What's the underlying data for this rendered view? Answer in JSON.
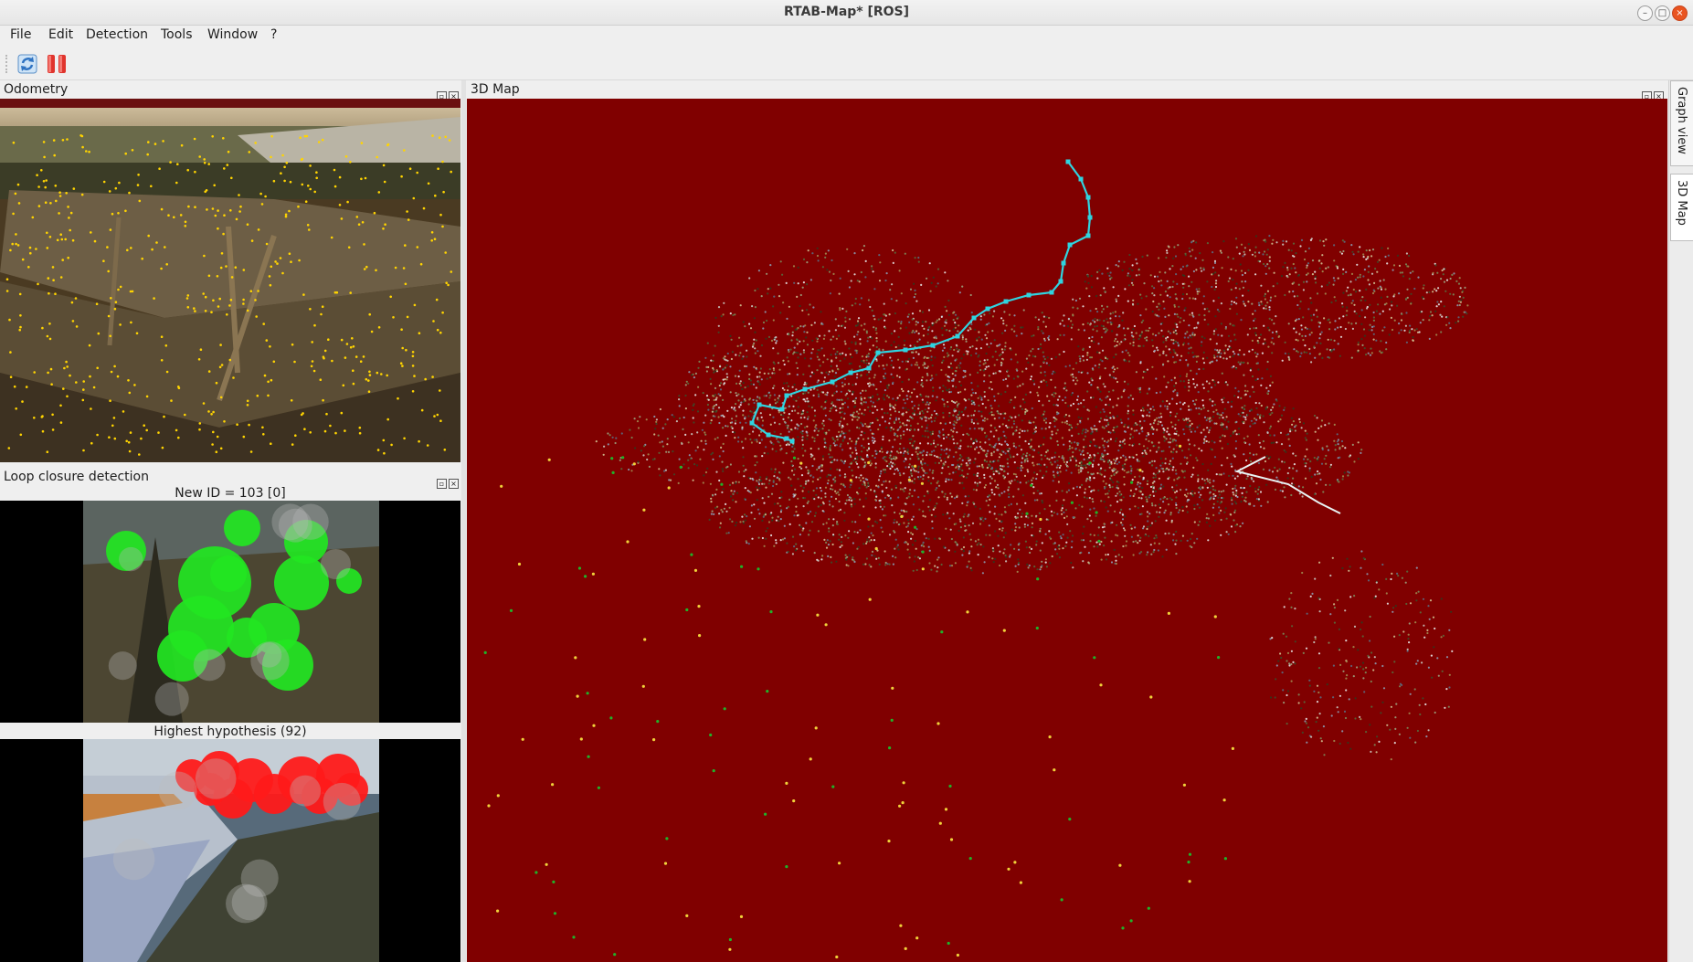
{
  "window": {
    "title": "RTAB-Map* [ROS]",
    "min_glyph": "–",
    "max_glyph": "□",
    "close_glyph": "×"
  },
  "menu": [
    "File",
    "Edit",
    "Detection",
    "Tools",
    "Window",
    "?"
  ],
  "toolbar": {
    "icons": [
      "refresh-icon",
      "pause-icon"
    ]
  },
  "odometry": {
    "title": "Odometry"
  },
  "loop_closure": {
    "title": "Loop closure detection",
    "new_caption": "New ID = 103 [0]",
    "hypothesis_caption": "Highest hypothesis (92)"
  },
  "map3d": {
    "title": "3D Map"
  },
  "side_tabs": [
    "Graph view",
    "3D Map"
  ],
  "colors": {
    "map_bg": "#800000",
    "trajectory": "#2fd4e0",
    "features_odom": "#ffd400",
    "new_loop_features": "#22e622",
    "hyp_features": "#ff1a1a"
  },
  "dock_buttons": {
    "float_glyph": "▫",
    "close_glyph": "×"
  }
}
